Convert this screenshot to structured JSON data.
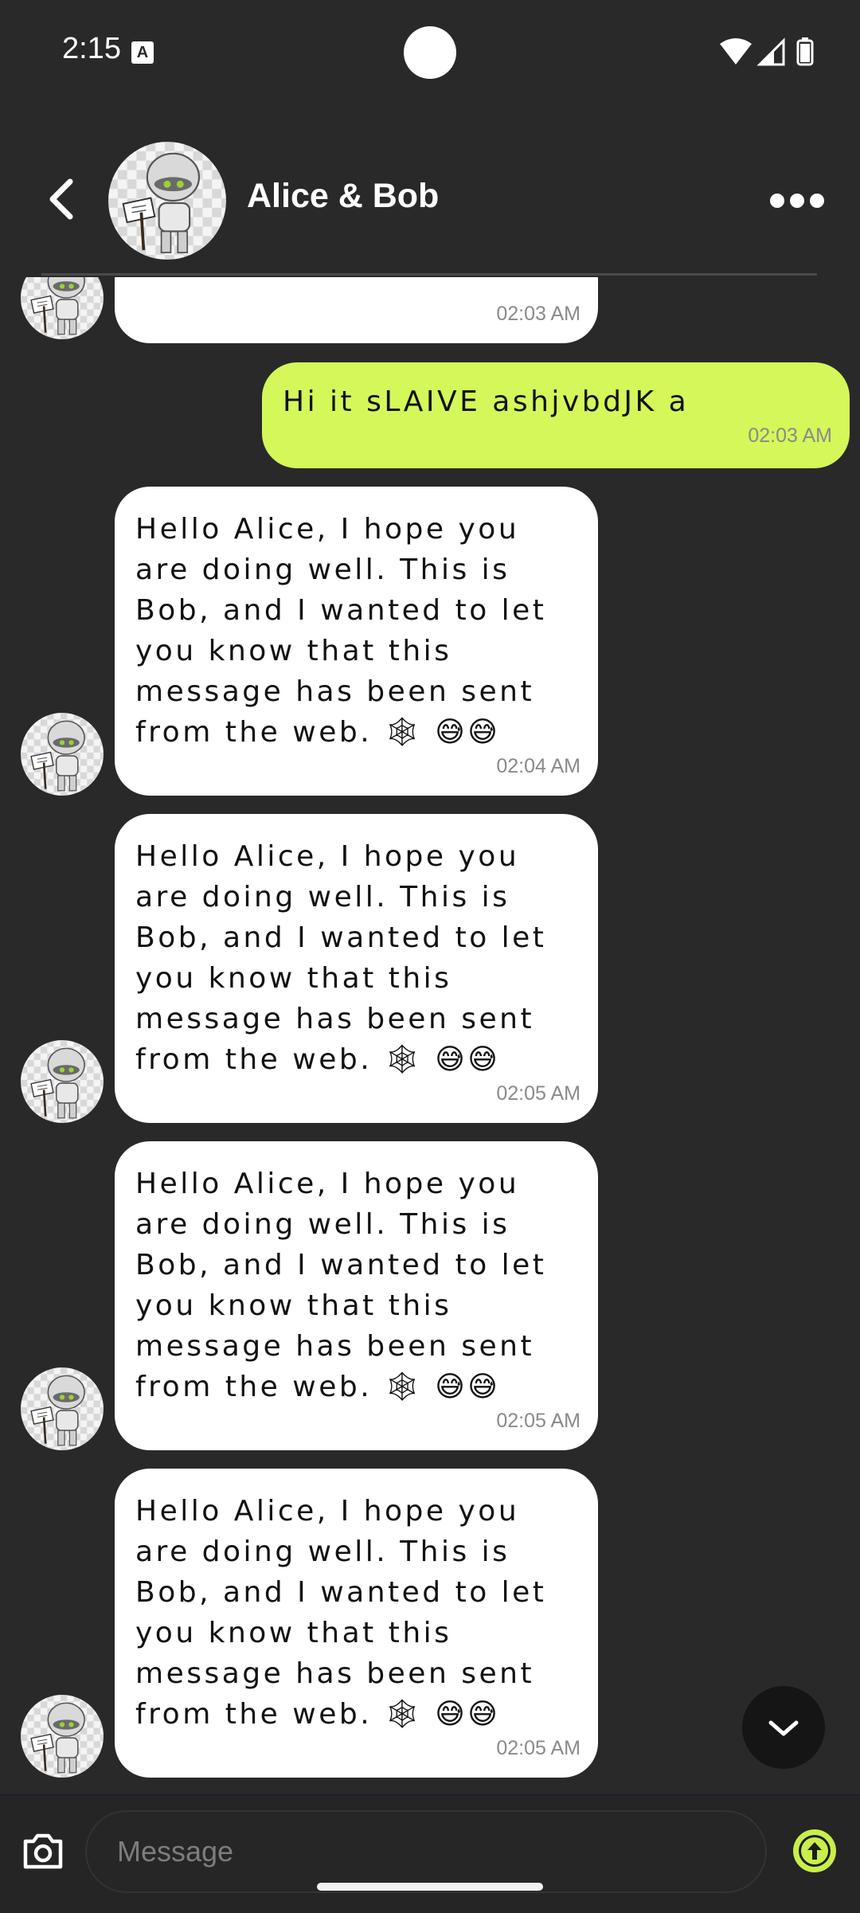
{
  "status_bar": {
    "time": "2:15",
    "notification_badge": "A"
  },
  "header": {
    "title": "Alice & Bob",
    "back_icon": "chevron-left-icon",
    "more_icon": "more-horizontal-icon"
  },
  "messages": [
    {
      "direction": "in",
      "text": "",
      "time": "02:03 AM"
    },
    {
      "direction": "out",
      "text": "Hi it sLAIVE ashjvbdJK a",
      "time": "02:03 AM"
    },
    {
      "direction": "in",
      "text": "Hello Alice, I hope you are doing well. This is Bob, and I wanted to let you know that this message has been sent from the web. 🕸 😅😅",
      "time": "02:04 AM"
    },
    {
      "direction": "in",
      "text": "Hello Alice, I hope you are doing well. This is Bob, and I wanted to let you know that this message has been sent from the web. 🕸 😅😅",
      "time": "02:05 AM"
    },
    {
      "direction": "in",
      "text": "Hello Alice, I hope you are doing well. This is Bob, and I wanted to let you know that this message has been sent from the web. 🕸 😅😅",
      "time": "02:05 AM"
    },
    {
      "direction": "in",
      "text": "Hello Alice, I hope you are doing well. This is Bob, and I wanted to let you know that this message has been sent from the web. 🕸 😅😅",
      "time": "02:05 AM"
    }
  ],
  "composer": {
    "placeholder": "Message",
    "camera_icon": "camera-icon",
    "send_icon": "send-arrow-up-icon"
  },
  "colors": {
    "background": "#292929",
    "outgoing_bubble": "#d4f75a",
    "incoming_bubble": "#ffffff",
    "accent": "#c8ef4a"
  }
}
